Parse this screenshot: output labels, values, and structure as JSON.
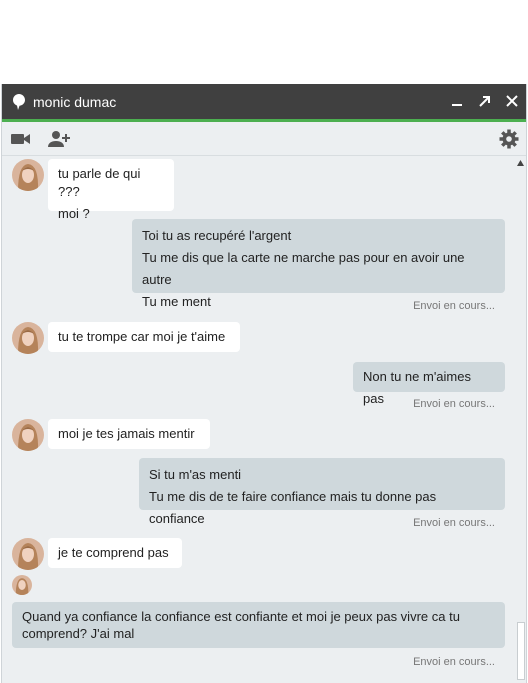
{
  "window": {
    "title": "monic dumac",
    "accent_color": "#4caf50",
    "titlebar_color": "#404040"
  },
  "titlebar_icons": [
    "chat-bubble-icon",
    "minimize-icon",
    "popout-icon",
    "close-icon"
  ],
  "toolbar_icons": [
    "video-camera-icon",
    "add-person-icon",
    "gear-icon"
  ],
  "messages": [
    {
      "from": "contact",
      "lines": [
        "tu parle de qui ???",
        "moi ?"
      ]
    },
    {
      "from": "me",
      "lines": [
        "Toi tu as recupéré l'argent",
        "Tu me dis que la carte ne marche pas pour en avoir une autre",
        "Tu me ment"
      ],
      "status": "Envoi en cours..."
    },
    {
      "from": "contact",
      "lines": [
        "tu te trompe car moi je t'aime"
      ]
    },
    {
      "from": "me",
      "lines": [
        "Non tu ne m'aimes pas"
      ],
      "status": "Envoi en cours..."
    },
    {
      "from": "contact",
      "lines": [
        "moi je tes jamais mentir"
      ]
    },
    {
      "from": "me",
      "lines": [
        "Si tu m'as menti",
        "Tu me dis de te faire confiance mais tu donne pas confiance"
      ],
      "status": "Envoi en cours..."
    },
    {
      "from": "contact",
      "lines": [
        "je te comprend pas"
      ]
    },
    {
      "from": "me",
      "lines": [
        "Quand ya confiance la confiance est confiante et moi je peux pas vivre ca tu comprend? J'ai mal"
      ],
      "status": "Envoi en cours..."
    }
  ]
}
